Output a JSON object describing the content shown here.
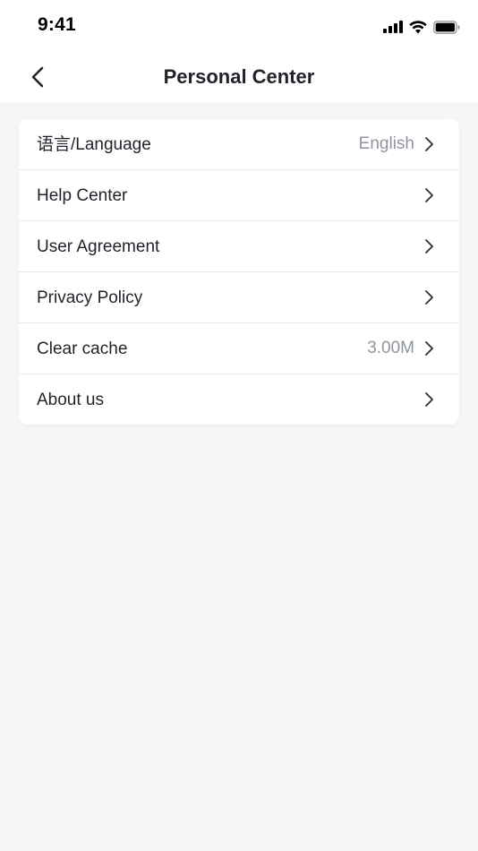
{
  "status_bar": {
    "time": "9:41",
    "icons": [
      "signal-icon",
      "wifi-icon",
      "battery-icon"
    ]
  },
  "nav": {
    "title": "Personal Center",
    "back_icon": "chevron-left-icon"
  },
  "settings": {
    "items": [
      {
        "label": "语言/Language",
        "value": "English"
      },
      {
        "label": "Help Center",
        "value": ""
      },
      {
        "label": "User Agreement",
        "value": ""
      },
      {
        "label": "Privacy Policy",
        "value": ""
      },
      {
        "label": "Clear cache",
        "value": "3.00M"
      },
      {
        "label": "About us",
        "value": ""
      }
    ],
    "chevron_icon": "chevron-right-icon"
  },
  "colors": {
    "background": "#f5f6f8",
    "surface": "#ffffff",
    "text_primary": "#1f2329",
    "text_secondary": "#8f959e",
    "divider": "#e6e8eb"
  }
}
